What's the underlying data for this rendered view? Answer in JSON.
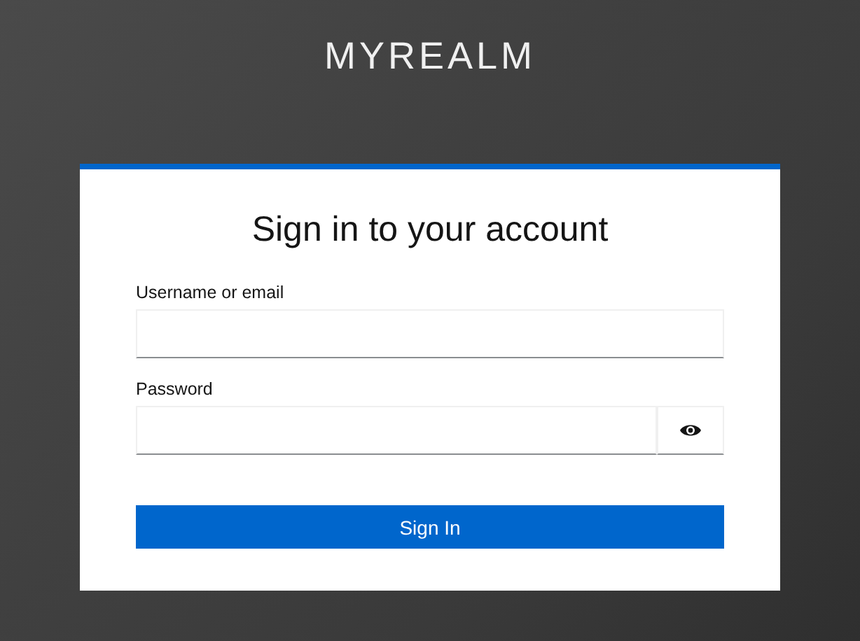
{
  "realm": {
    "title": "MYREALM"
  },
  "card": {
    "heading": "Sign in to your account",
    "fields": [
      {
        "kind": "text",
        "label": "Username or email"
      },
      {
        "kind": "password",
        "label": "Password"
      }
    ],
    "submit": "Sign In"
  }
}
